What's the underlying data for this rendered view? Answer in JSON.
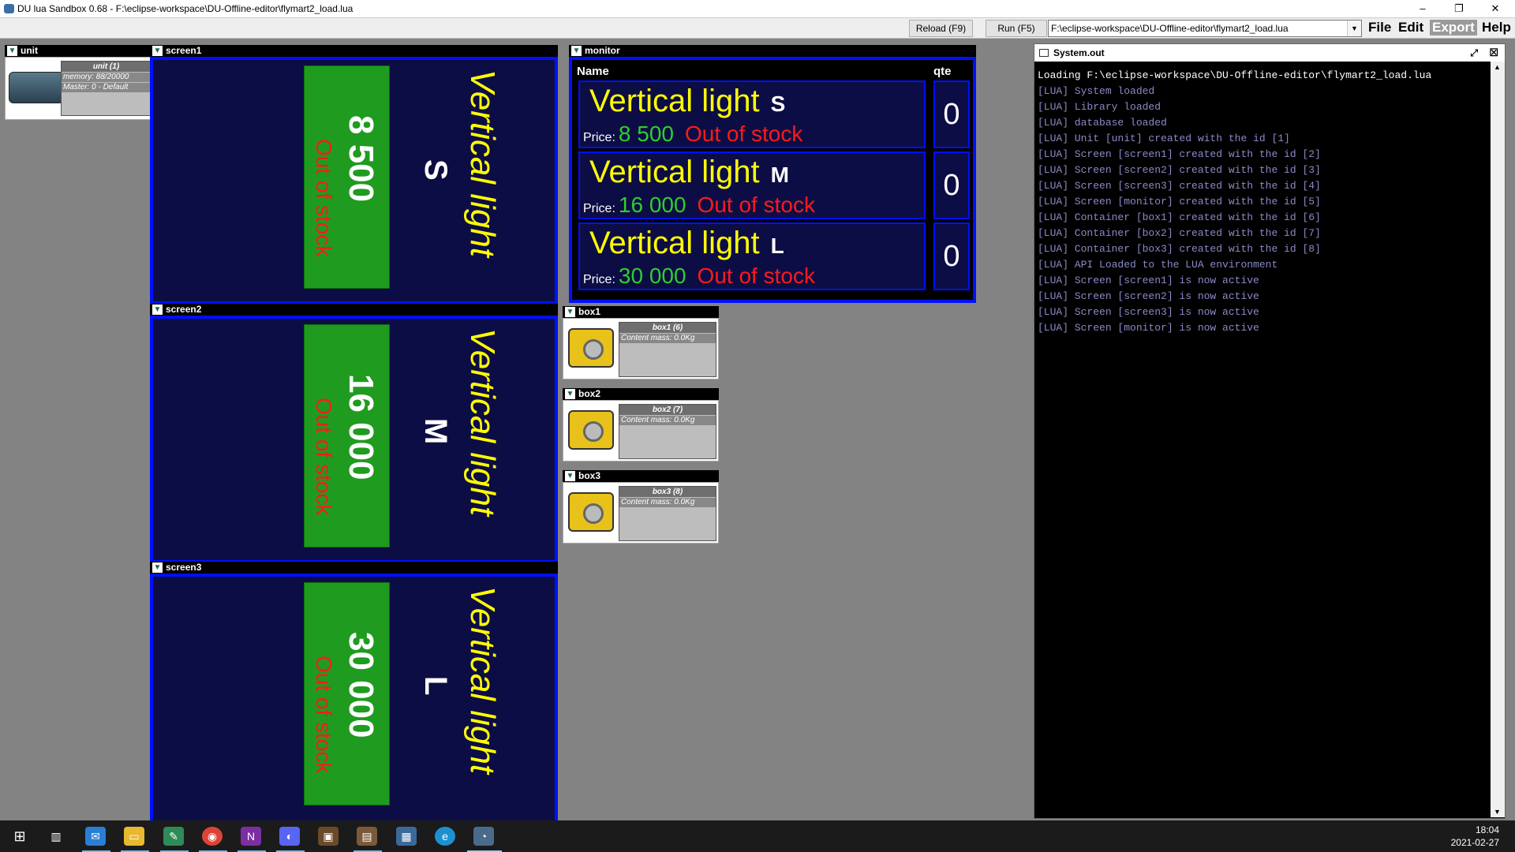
{
  "window": {
    "title": "DU lua Sandbox 0.68 - F:\\eclipse-workspace\\DU-Offline-editor\\flymart2_load.lua",
    "minimize": "–",
    "maximize": "❐",
    "close": "✕"
  },
  "toolbar": {
    "reload_label": "Reload (F9)",
    "run_label": "Run (F5)",
    "path_value": "F:\\eclipse-workspace\\DU-Offline-editor\\flymart2_load.lua",
    "menus": [
      "File",
      "Edit",
      "Export",
      "Help"
    ]
  },
  "unit": {
    "panel_title": "unit",
    "name": "unit (1)",
    "memory": "memory: 88/20000",
    "master": "Master: 0 - Default"
  },
  "screens": [
    {
      "panel_title": "screen1",
      "product": "Vertical light",
      "size": "S",
      "price": "8 500",
      "status": "Out of stock"
    },
    {
      "panel_title": "screen2",
      "product": "Vertical light",
      "size": "M",
      "price": "16 000",
      "status": "Out of stock"
    },
    {
      "panel_title": "screen3",
      "product": "Vertical light",
      "size": "L",
      "price": "30 000",
      "status": "Out of stock"
    }
  ],
  "monitor": {
    "panel_title": "monitor",
    "col_name": "Name",
    "col_qte": "qte",
    "price_label": "Price:",
    "rows": [
      {
        "name": "Vertical light",
        "size": "S",
        "price": "8 500",
        "status": "Out of stock",
        "qte": "0"
      },
      {
        "name": "Vertical light",
        "size": "M",
        "price": "16 000",
        "status": "Out of stock",
        "qte": "0"
      },
      {
        "name": "Vertical light",
        "size": "L",
        "price": "30 000",
        "status": "Out of stock",
        "qte": "0"
      }
    ]
  },
  "boxes": [
    {
      "panel_title": "box1",
      "name": "box1 (6)",
      "mass_label": "Content mass:",
      "mass": "0.0Kg"
    },
    {
      "panel_title": "box2",
      "name": "box2 (7)",
      "mass_label": "Content mass:",
      "mass": "0.0Kg"
    },
    {
      "panel_title": "box3",
      "name": "box3 (8)",
      "mass_label": "Content mass:",
      "mass": "0.0Kg"
    }
  ],
  "sysout": {
    "title": "System.out",
    "lines": [
      "Loading F:\\eclipse-workspace\\DU-Offline-editor\\flymart2_load.lua",
      "[LUA] System loaded",
      "[LUA] Library loaded",
      "[LUA] database loaded",
      "[LUA] Unit [unit] created with the id [1]",
      "[LUA] Screen [screen1] created with the id [2]",
      "[LUA] Screen [screen2] created with the id [3]",
      "[LUA] Screen [screen3] created with the id [4]",
      "[LUA] Screen [monitor] created with the id [5]",
      "[LUA] Container [box1] created with the id [6]",
      "[LUA] Container [box2] created with the id [7]",
      "[LUA] Container [box3] created with the id [8]",
      "[LUA] API Loaded to the LUA environment",
      "[LUA] Screen [screen1] is now active",
      "[LUA] Screen [screen2] is now active",
      "[LUA] Screen [screen3] is now active",
      "[LUA] Screen [monitor] is now active"
    ]
  },
  "taskbar": {
    "time": "18:04",
    "date": "2021-02-27"
  },
  "colors": {
    "screen_bg": "#0d0d45",
    "screen_border": "#0010ff",
    "product_yellow": "#ffff00",
    "price_green": "#2cd02c",
    "stock_red": "#ff1a1a"
  }
}
